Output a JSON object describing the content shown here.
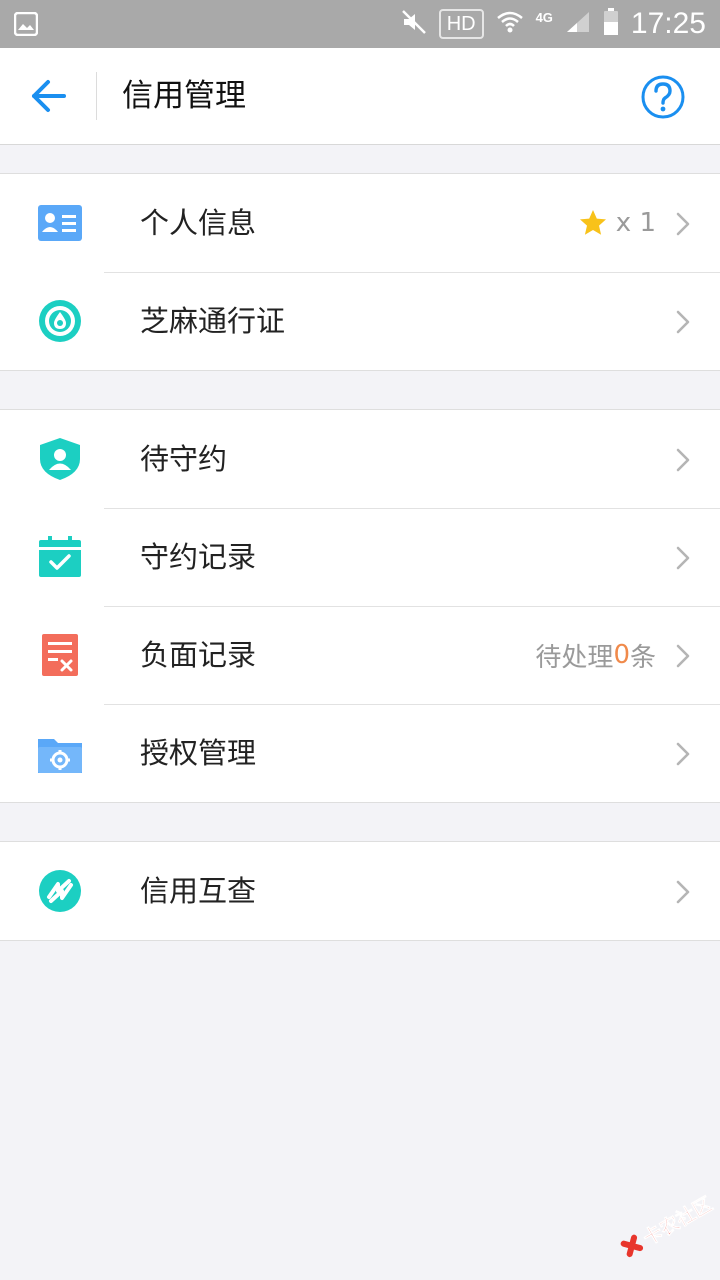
{
  "status_bar": {
    "hd": "HD",
    "network": "4G",
    "time": "17:25"
  },
  "nav": {
    "title": "信用管理"
  },
  "sections": [
    [
      {
        "label": "个人信息",
        "icon": "id-card-icon",
        "right_text": "x 1",
        "has_star": true
      },
      {
        "label": "芝麻通行证",
        "icon": "sesame-pass-icon"
      }
    ],
    [
      {
        "label": "待守约",
        "icon": "shield-user-icon"
      },
      {
        "label": "守约记录",
        "icon": "calendar-check-icon"
      },
      {
        "label": "负面记录",
        "icon": "negative-record-icon",
        "right_prefix": "待处理",
        "right_count": "0",
        "right_suffix": "条"
      },
      {
        "label": "授权管理",
        "icon": "folder-gear-icon"
      }
    ],
    [
      {
        "label": "信用互查",
        "icon": "credit-check-icon"
      }
    ]
  ],
  "watermark": {
    "text": "卡农社区"
  },
  "colors": {
    "accent_blue": "#1a8ff0",
    "teal": "#1ccfc2",
    "coral": "#f36d5b",
    "light_blue": "#5aa8f8",
    "star": "#f8c21a",
    "count_orange": "#f08a4b"
  }
}
